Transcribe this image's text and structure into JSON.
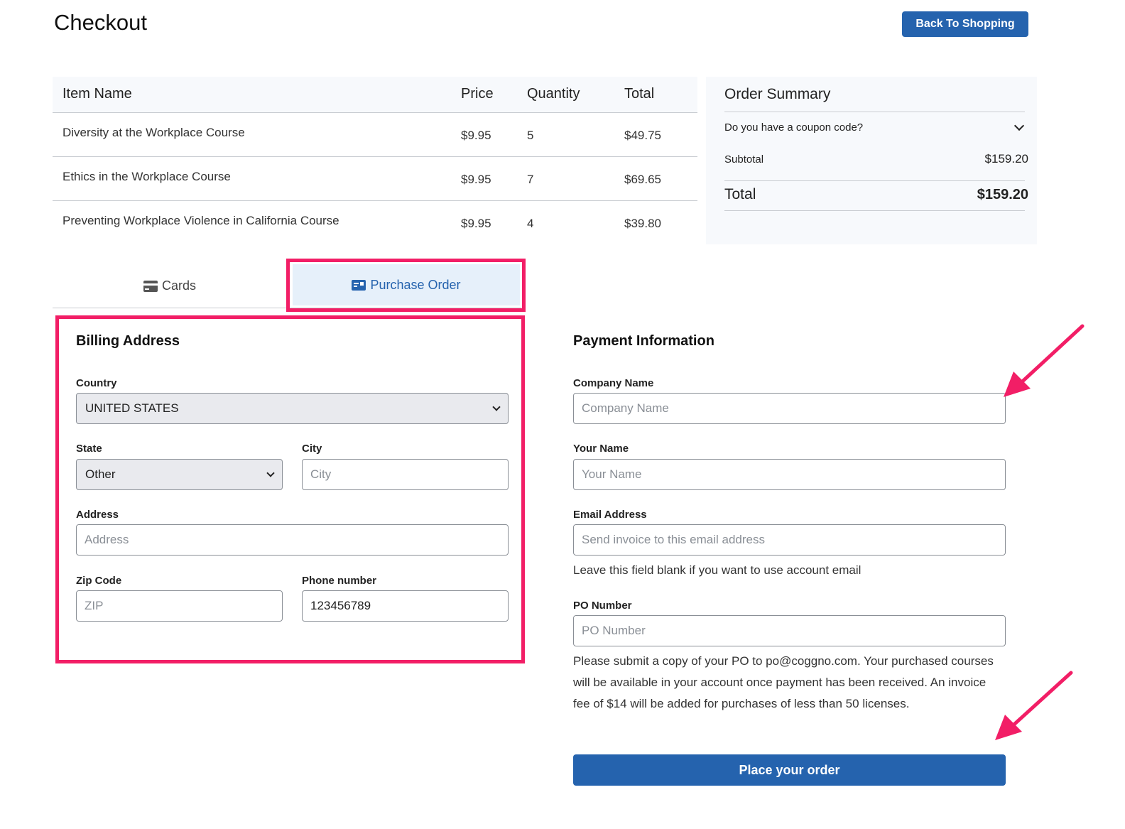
{
  "header": {
    "title": "Checkout",
    "back_label": "Back To Shopping"
  },
  "table": {
    "columns": [
      "Item Name",
      "Price",
      "Quantity",
      "Total"
    ],
    "rows": [
      [
        "Diversity at the Workplace Course",
        "$9.95",
        "5",
        "$49.75"
      ],
      [
        "Ethics in the Workplace Course",
        "$9.95",
        "7",
        "$69.65"
      ],
      [
        "Preventing Workplace Violence in California Course",
        "$9.95",
        "4",
        "$39.80"
      ]
    ]
  },
  "summary": {
    "title": "Order Summary",
    "coupon": "Do you have a coupon code?",
    "subtotal_label": "Subtotal",
    "subtotal_value": "$159.20",
    "total_label": "Total",
    "total_value": "$159.20"
  },
  "tabs": {
    "cards": "Cards",
    "po": "Purchase Order"
  },
  "billing": {
    "title": "Billing Address",
    "country_label": "Country",
    "country_value": "UNITED STATES",
    "state_label": "State",
    "state_value": "Other",
    "city_label": "City",
    "city_placeholder": "City",
    "address_label": "Address",
    "address_placeholder": "Address",
    "zip_label": "Zip Code",
    "zip_placeholder": "ZIP",
    "phone_label": "Phone number",
    "phone_value": "123456789"
  },
  "payment": {
    "title": "Payment Information",
    "company_label": "Company Name",
    "company_placeholder": "Company Name",
    "name_label": "Your Name",
    "name_placeholder": "Your Name",
    "email_label": "Email Address",
    "email_placeholder": "Send invoice to this email address",
    "email_help": "Leave this field blank if you want to use account email",
    "po_label": "PO Number",
    "po_placeholder": "PO Number",
    "po_note": "Please submit a copy of your PO to po@coggno.com. Your purchased courses will be available in your account once payment has been received. An invoice fee of $14 will be added for purchases of less than 50 licenses.",
    "submit_label": "Place your order"
  },
  "colors": {
    "accent": "#2563ae",
    "highlight": "#f21e66",
    "panel": "#f7f9fc",
    "tab_active_bg": "#e6f0fa"
  }
}
